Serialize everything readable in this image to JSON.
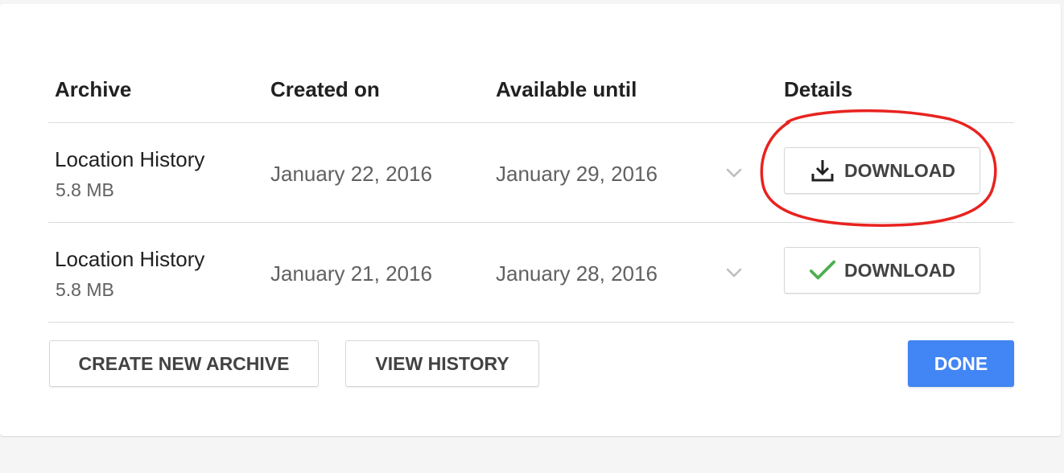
{
  "table": {
    "headers": {
      "archive": "Archive",
      "created_on": "Created on",
      "available_until": "Available until",
      "details": "Details"
    },
    "rows": [
      {
        "name": "Location History",
        "size": "5.8 MB",
        "created_on": "January 22, 2016",
        "available_until": "January 29, 2016",
        "expand_icon": "chevron-down-icon",
        "button_icon": "download-icon",
        "button_label": "DOWNLOAD"
      },
      {
        "name": "Location History",
        "size": "5.8 MB",
        "created_on": "January 21, 2016",
        "available_until": "January 28, 2016",
        "expand_icon": "chevron-down-icon",
        "button_icon": "checkmark-icon",
        "button_label": "DOWNLOAD"
      }
    ]
  },
  "footer": {
    "create_label": "CREATE NEW ARCHIVE",
    "history_label": "VIEW HISTORY",
    "done_label": "DONE"
  },
  "colors": {
    "done_button": "#4285f4",
    "annotation": "#e8231f",
    "checkmark": "#4caf50"
  }
}
